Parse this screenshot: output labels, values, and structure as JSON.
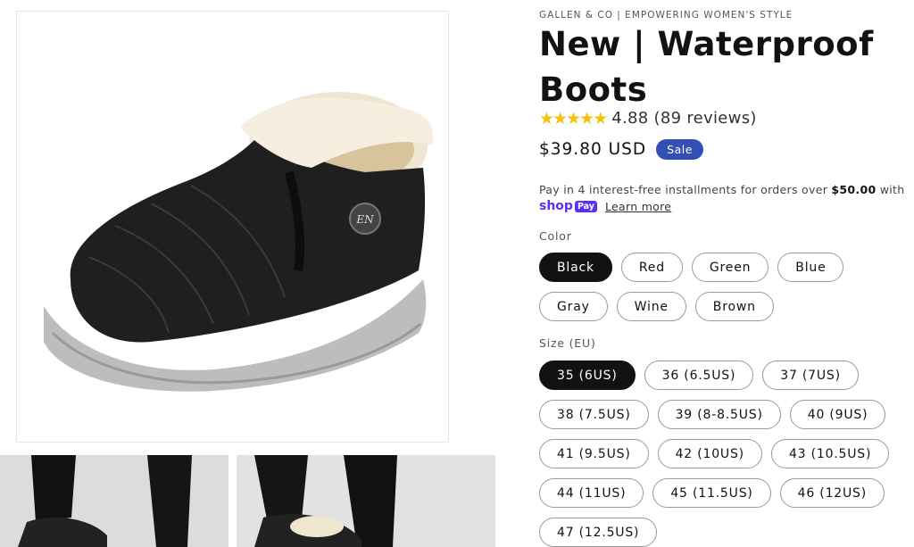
{
  "gallery": {
    "main_image_alt": "Black waterproof ankle boot with fur lining",
    "thumbnails": [
      "thumbnail-1",
      "thumbnail-2"
    ]
  },
  "product": {
    "vendor": "GALLEN & CO | EMPOWERING WOMEN'S STYLE",
    "title": "New | Waterproof Boots",
    "rating": {
      "stars": 5,
      "value": "4.88",
      "reviews": "(89 reviews)"
    },
    "price": "$39.80 USD",
    "badge": "Sale",
    "installments": {
      "text": "Pay in 4 interest-free installments for orders over ",
      "amount": "$50.00",
      "suffix": " with"
    },
    "shop_pay": {
      "shop": "shop",
      "pay": "Pay",
      "learn_more": "Learn more"
    }
  },
  "options": {
    "color": {
      "label": "Color",
      "selected": "Black",
      "values": [
        "Black",
        "Red",
        "Green",
        "Blue",
        "Gray",
        "Wine",
        "Brown"
      ]
    },
    "size": {
      "label": "Size (EU)",
      "selected": "35 (6US)",
      "values": [
        "35 (6US)",
        "36 (6.5US)",
        "37 (7US)",
        "38 (7.5US)",
        "39 (8-8.5US)",
        "40 (9US)",
        "41 (9.5US)",
        "42 (10US)",
        "43 (10.5US)",
        "44 (11US)",
        "45 (11.5US)",
        "46 (12US)",
        "47 (12.5US)"
      ]
    }
  },
  "colors": {
    "sale_badge": "#334fb4",
    "shop_pay": "#5a31f4",
    "star": "#f4c20d",
    "selected_pill": "#121212"
  }
}
